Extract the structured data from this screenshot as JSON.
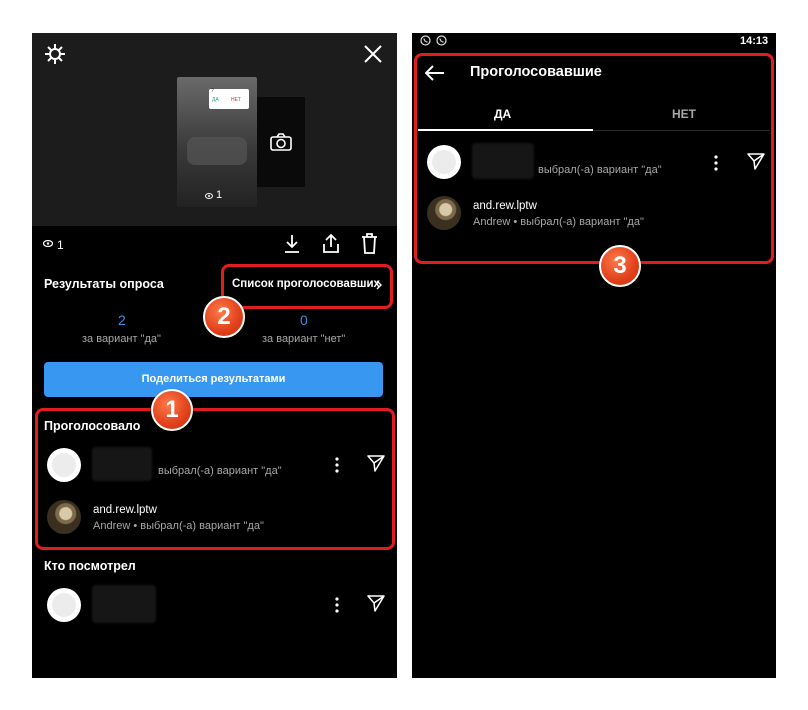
{
  "left": {
    "story_viewer_count": "1",
    "toolbar_viewer_count": "1",
    "preview": {
      "sticker_question": "?",
      "sticker_yes": "ДА",
      "sticker_no": "НЕТ"
    },
    "results": {
      "title": "Результаты опроса",
      "voters_list_link": "Список проголосовавших",
      "yes_count": "2",
      "yes_label": "за вариант \"да\"",
      "no_count": "0",
      "no_label": "за вариант \"нет\""
    },
    "share_button": "Поделиться результатами",
    "voted": {
      "heading": "Проголосовало",
      "items": [
        {
          "username": "",
          "detail": "выбрал(-а) вариант \"да\""
        },
        {
          "username": "and.rew.lptw",
          "detail": "Andrew • выбрал(-а) вариант \"да\""
        }
      ]
    },
    "viewers": {
      "heading": "Кто посмотрел"
    }
  },
  "right": {
    "status_bar": {
      "time": "14:13"
    },
    "title": "Проголосовавшие",
    "tabs": [
      {
        "label": "ДА",
        "active": true
      },
      {
        "label": "НЕТ",
        "active": false
      }
    ],
    "items": [
      {
        "username": "",
        "detail": "выбрал(-а) вариант \"да\""
      },
      {
        "username": "and.rew.lptw",
        "detail": "Andrew • выбрал(-а) вариант \"да\""
      }
    ]
  },
  "badges": [
    "1",
    "2",
    "3"
  ],
  "colors": {
    "accent_blue": "#3897f0",
    "link_blue": "#3d8fe0",
    "highlight_red": "#e01e1e",
    "badge_orange": "#e0401a"
  },
  "icons": [
    "settings-icon",
    "close-icon",
    "camera-icon",
    "eye-icon",
    "download-icon",
    "share-icon",
    "trash-icon",
    "chevron-right-icon",
    "more-icon",
    "send-icon",
    "back-arrow-icon",
    "viber-icon"
  ]
}
